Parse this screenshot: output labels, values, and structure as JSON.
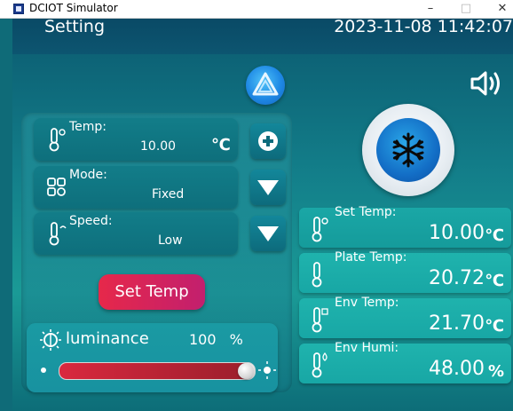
{
  "window": {
    "title": "DCIOT Simulator",
    "minimize": "–",
    "maximize": "□",
    "close": "✕"
  },
  "header": {
    "title": "Setting",
    "datetime": "2023-11-08 11:42:07"
  },
  "left_controls": [
    {
      "label": "Temp:",
      "value": "10.00",
      "unit": "℃"
    },
    {
      "label": "Mode:",
      "value": "Fixed"
    },
    {
      "label": "Speed:",
      "value": "Low"
    }
  ],
  "buttons": {
    "set_temp": "Set Temp"
  },
  "luminance": {
    "label": "luminance",
    "value": "100",
    "unit": "%",
    "level": 1.0
  },
  "right_readings": [
    {
      "label": "Set Temp:",
      "value": "10.00",
      "unit": "℃"
    },
    {
      "label": "Plate Temp:",
      "value": "20.72",
      "unit": "℃"
    },
    {
      "label": "Env Temp:",
      "value": "21.70",
      "unit": "℃"
    },
    {
      "label": "Env Humi:",
      "value": "48.00",
      "unit": "%"
    }
  ],
  "icons": {
    "logo": "triangle-logo-icon",
    "speaker": "speaker-icon",
    "snowflake": "snowflake-icon",
    "plus": "plus-icon",
    "down": "chevron-down-icon",
    "thermometer": "thermometer-icon",
    "mode": "mode-grid-icon",
    "sun": "sun-icon"
  },
  "colors": {
    "accent_red": "#e6284a",
    "snow_blue": "#136ec6",
    "panel_teal": "#127d89"
  }
}
